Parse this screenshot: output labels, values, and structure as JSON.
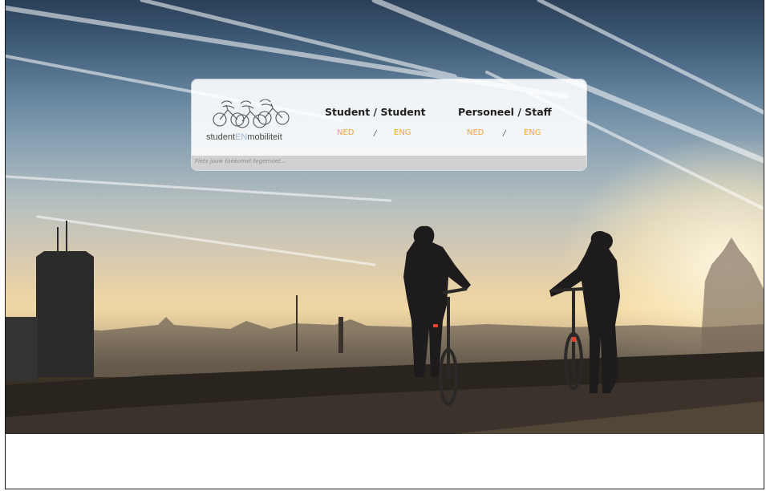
{
  "logo": {
    "part1": "student",
    "part2": "EN",
    "part3": "mobiliteit"
  },
  "sections": [
    {
      "title": "Student / Student",
      "links": [
        "NED",
        "ENG"
      ],
      "separator": "/"
    },
    {
      "title": "Personeel / Staff",
      "links": [
        "NED",
        "ENG"
      ],
      "separator": "/"
    }
  ],
  "tagline": "Fiets jouw toekomst tegemoet...",
  "colors": {
    "link": "#f2a43a",
    "title": "#1f1f1f",
    "logo_en": "#9db7cf"
  }
}
